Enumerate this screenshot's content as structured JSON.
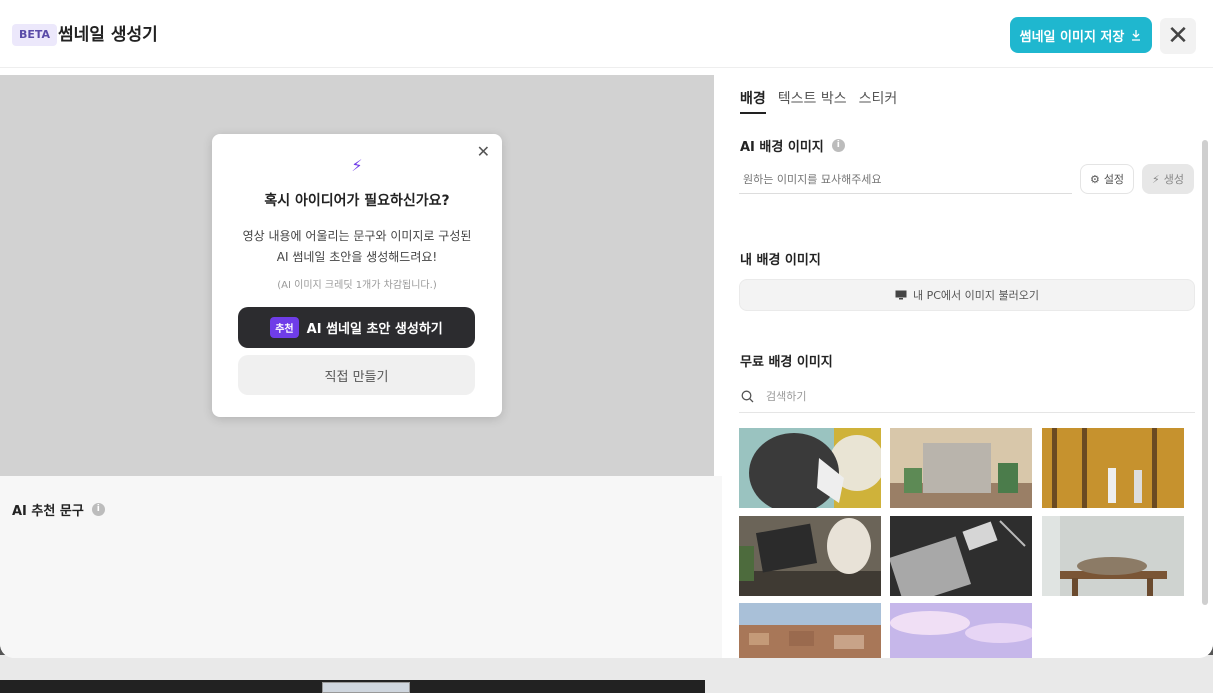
{
  "header": {
    "badge": "BETA",
    "title": "썸네일 생성기",
    "save_label": "썸네일 이미지 저장",
    "save_icon": "download-icon",
    "close_icon": "close-icon"
  },
  "popup": {
    "bolt_icon": "bolt-icon",
    "question": "혹시 아이디어가 필요하신가요?",
    "desc_line1": "영상 내용에 어울리는 문구와 이미지로 구성된",
    "desc_line2": "AI 썸네일 초안을 생성해드려요!",
    "note": "(AI 이미지 크레딧 1개가 차감됩니다.)",
    "tag": "추천",
    "generate_label": "AI 썸네일 초안 생성하기",
    "manual_label": "직접 만들기"
  },
  "left": {
    "ai_rec_label": "AI 추천 문구"
  },
  "right": {
    "tabs": [
      {
        "label": "배경",
        "active": true
      },
      {
        "label": "텍스트 박스",
        "active": false
      },
      {
        "label": "스티커",
        "active": false
      }
    ],
    "ai_bg_title": "AI 배경 이미지",
    "prompt_placeholder": "원하는 이미지를 묘사해주세요",
    "settings_label": "설정",
    "generate_label": "생성",
    "my_bg_title": "내 배경 이미지",
    "pc_load_label": "내 PC에서 이미지 불러오기",
    "free_bg_title": "무료 배경 이미지",
    "search_placeholder": "검색하기",
    "images": [
      "illustration-hands",
      "illustration-cabinet-plants",
      "photo-couple-forest",
      "photo-laptop-typing",
      "photo-laptop-desk",
      "photo-cat-table",
      "photo-city-skyline",
      "photo-pastel-clouds"
    ]
  },
  "colors": {
    "accent": "#1fb7cf",
    "purple": "#6f3de8",
    "dark_button": "#2c2c2f"
  }
}
